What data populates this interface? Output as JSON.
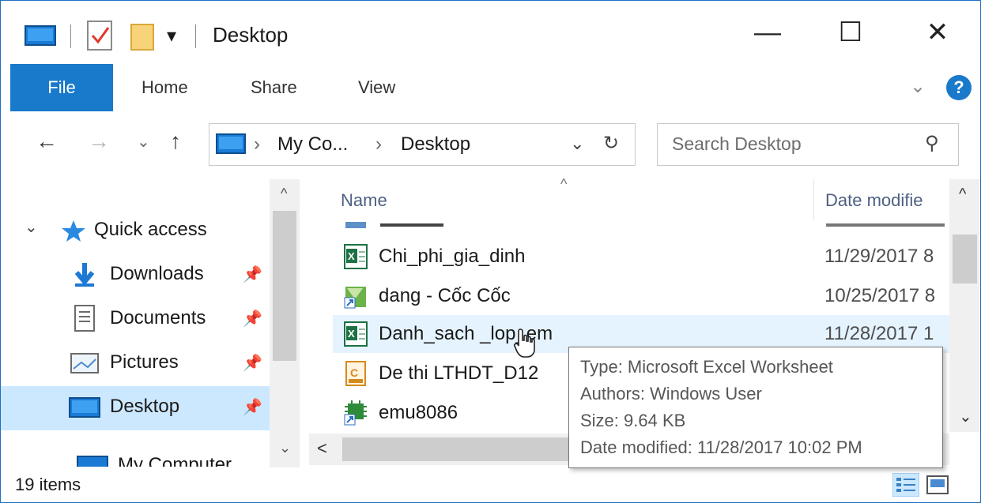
{
  "window": {
    "title": "Desktop",
    "qa_dropdown": "▾",
    "minimize": "—",
    "maximize": "☐",
    "close": "✕"
  },
  "ribbon": {
    "tabs": [
      "File",
      "Home",
      "Share",
      "View"
    ],
    "expand": "⌄",
    "help": "?"
  },
  "nav": {
    "back": "←",
    "forward": "→",
    "recent": "⌄",
    "up": "↑",
    "breadcrumb": [
      "My Co...",
      "Desktop"
    ],
    "sep": "›",
    "dropdown": "⌄",
    "refresh": "↻",
    "search_placeholder": "Search Desktop",
    "search_icon": "⚲"
  },
  "navpane": {
    "collapse": "⌄",
    "items": [
      {
        "label": "Quick access",
        "pinned": false,
        "selected": false
      },
      {
        "label": "Downloads",
        "pinned": true,
        "selected": false
      },
      {
        "label": "Documents",
        "pinned": true,
        "selected": false
      },
      {
        "label": "Pictures",
        "pinned": true,
        "selected": false
      },
      {
        "label": "Desktop",
        "pinned": true,
        "selected": true
      }
    ],
    "cutoff_label": "My Computer",
    "pin_glyph": "📌"
  },
  "columns": {
    "name": "Name",
    "date": "Date modifie",
    "sort_indicator": "^"
  },
  "files": [
    {
      "name": "Chi_phi_gia_dinh",
      "date": "11/29/2017 8",
      "icon": "excel-file-icon"
    },
    {
      "name": "dang - Cốc Cốc",
      "date": "10/25/2017 8",
      "icon": "coccoc-shortcut-icon"
    },
    {
      "name": "Danh_sach _lop_em",
      "date": "11/28/2017 1",
      "icon": "excel-file-icon",
      "hover": true
    },
    {
      "name": "De thi LTHDT_D12",
      "date": "",
      "icon": "source-file-icon"
    },
    {
      "name": "emu8086",
      "date": "",
      "icon": "emu8086-shortcut-icon"
    }
  ],
  "tooltip": {
    "type": "Type: Microsoft Excel Worksheet",
    "authors": "Authors: Windows User",
    "size": "Size: 9.64 KB",
    "date_modified": "Date modified: 11/28/2017 10:02 PM"
  },
  "status": {
    "count": "19 items"
  },
  "scroll": {
    "up": "^",
    "down": "⌄",
    "left": "<"
  },
  "colors": {
    "accent": "#1979ca",
    "selected_bg": "#cce8ff",
    "hover_bg": "#e5f3ff"
  }
}
